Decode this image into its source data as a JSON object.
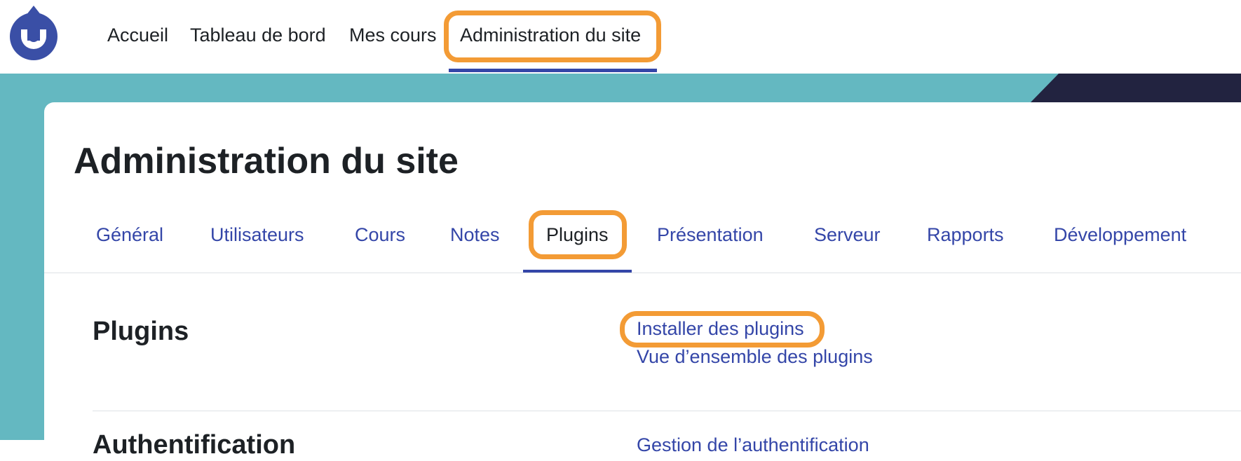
{
  "navbar": {
    "logo_icon": "moodle-logo-icon",
    "items": [
      {
        "label": "Accueil"
      },
      {
        "label": "Tableau de bord"
      },
      {
        "label": "Mes cours"
      },
      {
        "label": "Administration du site",
        "active": true
      }
    ]
  },
  "page": {
    "title": "Administration du site"
  },
  "tabs": [
    {
      "label": "Général"
    },
    {
      "label": "Utilisateurs"
    },
    {
      "label": "Cours"
    },
    {
      "label": "Notes"
    },
    {
      "label": "Plugins",
      "active": true
    },
    {
      "label": "Présentation"
    },
    {
      "label": "Serveur"
    },
    {
      "label": "Rapports"
    },
    {
      "label": "Développement"
    }
  ],
  "sections": [
    {
      "title": "Plugins",
      "links": [
        {
          "label": "Installer des plugins",
          "highlighted": true
        },
        {
          "label": "Vue d’ensemble des plugins"
        }
      ]
    },
    {
      "title": "Authentification",
      "links": [
        {
          "label": "Gestion de l’authentification"
        }
      ]
    }
  ],
  "colors": {
    "accent": "#3446a8",
    "highlight": "#f39b35",
    "band": "#64b8c1",
    "band_dark": "#222340"
  }
}
